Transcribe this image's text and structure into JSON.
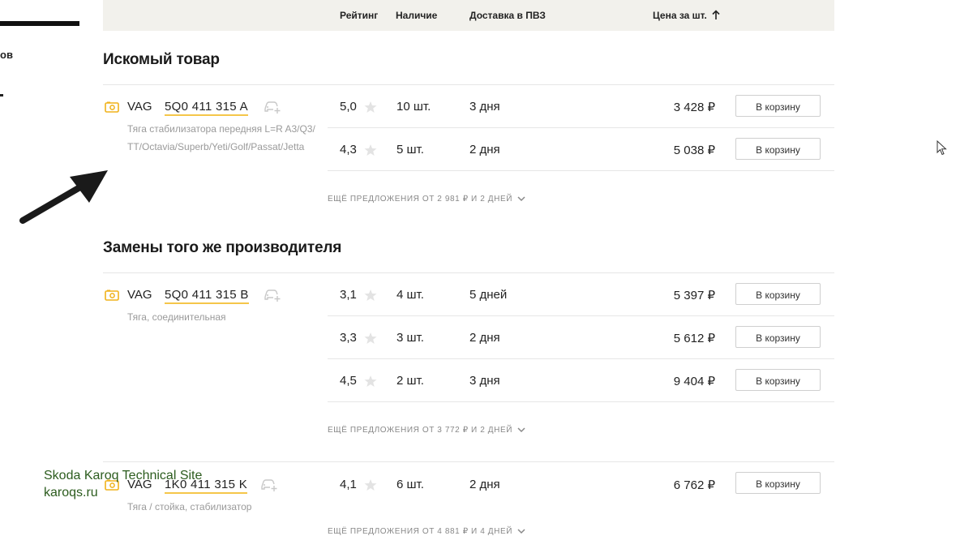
{
  "sidebar": {
    "partial_text": "ов"
  },
  "header": {
    "col_rating": "Рейтинг",
    "col_stock": "Наличие",
    "col_delivery": "Доставка в ПВЗ",
    "col_price": "Цена за шт."
  },
  "sections": [
    {
      "title": "Искомый товар",
      "product": {
        "brand": "VAG",
        "code": "5Q0 411 315 A",
        "description": "Тяга стабилизатора передняя L=R A3/Q3/TT/Octavia/Superb/Yeti/Golf/Passat/Jetta"
      },
      "offers": [
        {
          "rating": "5,0",
          "stock": "10 шт.",
          "delivery": "3 дня",
          "price": "3 428 ₽",
          "button": "В корзину"
        },
        {
          "rating": "4,3",
          "stock": "5 шт.",
          "delivery": "2 дня",
          "price": "5 038 ₽",
          "button": "В корзину"
        }
      ],
      "more_offers": "ЕЩЁ ПРЕДЛОЖЕНИЯ ОТ 2 981 ₽ И 2 ДНЕЙ"
    },
    {
      "title": "Замены того же производителя",
      "product": {
        "brand": "VAG",
        "code": "5Q0 411 315 B",
        "description": "Тяга, соединительная"
      },
      "offers": [
        {
          "rating": "3,1",
          "stock": "4 шт.",
          "delivery": "5 дней",
          "price": "5 397 ₽",
          "button": "В корзину"
        },
        {
          "rating": "3,3",
          "stock": "3 шт.",
          "delivery": "2 дня",
          "price": "5 612 ₽",
          "button": "В корзину"
        },
        {
          "rating": "4,5",
          "stock": "2 шт.",
          "delivery": "3 дня",
          "price": "9 404 ₽",
          "button": "В корзину"
        }
      ],
      "more_offers": "ЕЩЁ ПРЕДЛОЖЕНИЯ ОТ 3 772 ₽ И 2 ДНЕЙ"
    },
    {
      "product": {
        "brand": "VAG",
        "code": "1K0 411 315 K",
        "description": "Тяга / стойка, стабилизатор"
      },
      "offers": [
        {
          "rating": "4,1",
          "stock": "6 шт.",
          "delivery": "2 дня",
          "price": "6 762 ₽",
          "button": "В корзину"
        }
      ],
      "more_offers": "ЕЩЁ ПРЕДЛОЖЕНИЯ ОТ 4 881 ₽ И 4 ДНЕЙ"
    }
  ],
  "watermark": {
    "line1": "Skoda Karoq Technical Site",
    "line2": "karoqs.ru"
  },
  "colors": {
    "accent_yellow": "#f5c64a",
    "header_bg": "#f2f1ec",
    "watermark_green": "#2c5c1e"
  },
  "icons": [
    "camera-icon",
    "car-add-icon",
    "star-icon",
    "arrow-up-icon",
    "chevron-down-icon",
    "mouse-cursor-icon",
    "pointer-arrow-icon"
  ]
}
